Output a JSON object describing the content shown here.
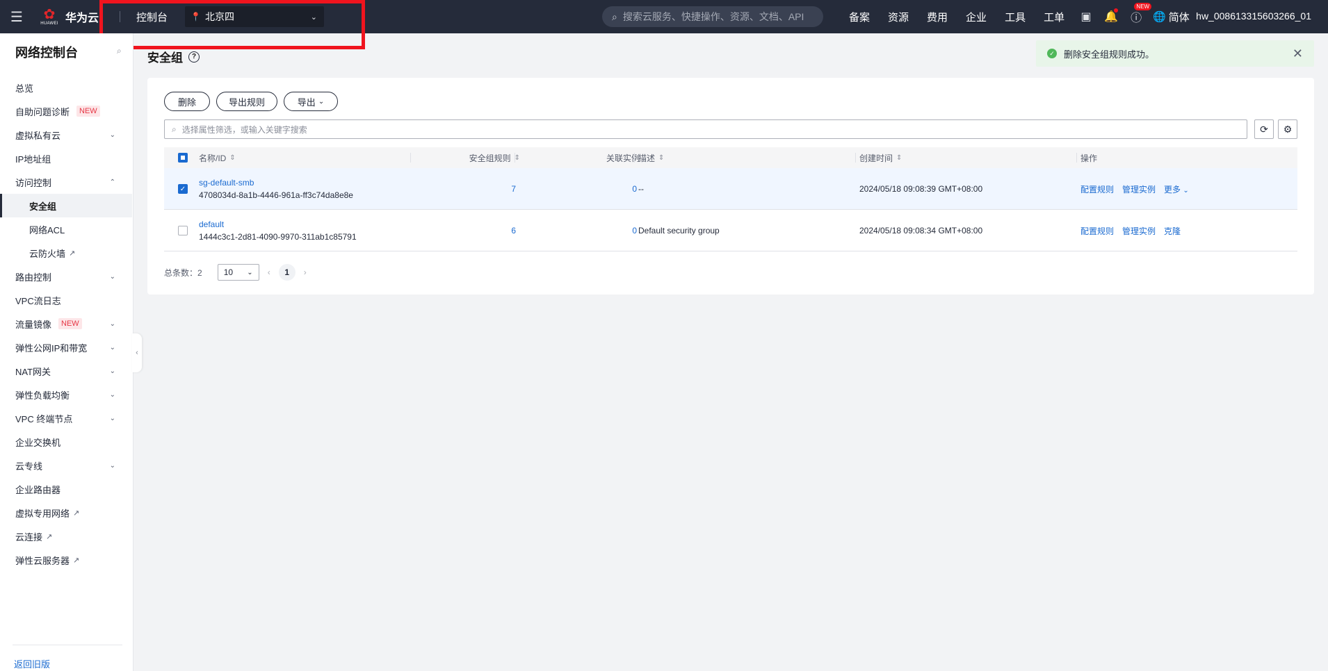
{
  "topbar": {
    "brand_sub": "HUAWEI",
    "brand": "华为云",
    "console": "控制台",
    "region": "北京四",
    "search_placeholder": "搜索云服务、快捷操作、资源、文档、API",
    "links": [
      "备案",
      "资源",
      "费用",
      "企业",
      "工具",
      "工单"
    ],
    "new_badge": "NEW",
    "lang": "简体",
    "user": "hw_008613315603266_01"
  },
  "sidebar": {
    "title": "网络控制台",
    "items": [
      {
        "label": "总览"
      },
      {
        "label": "自助问题诊断",
        "tag": "NEW"
      },
      {
        "label": "虚拟私有云"
      },
      {
        "label": "IP地址组"
      },
      {
        "label": "访问控制"
      },
      {
        "label": "安全组"
      },
      {
        "label": "网络ACL"
      },
      {
        "label": "云防火墙"
      },
      {
        "label": "路由控制"
      },
      {
        "label": "VPC流日志"
      },
      {
        "label": "流量镜像",
        "tag": "NEW"
      },
      {
        "label": "弹性公网IP和带宽"
      },
      {
        "label": "NAT网关"
      },
      {
        "label": "弹性负载均衡"
      },
      {
        "label": "VPC 终端节点"
      },
      {
        "label": "企业交换机"
      },
      {
        "label": "云专线"
      },
      {
        "label": "企业路由器"
      },
      {
        "label": "虚拟专用网络"
      },
      {
        "label": "云连接"
      },
      {
        "label": "弹性云服务器"
      }
    ],
    "back": "返回旧版"
  },
  "main": {
    "title": "安全组",
    "toast": "删除安全组规则成功。",
    "buttons": {
      "delete": "删除",
      "export_rules": "导出规则",
      "export": "导出"
    },
    "filter_placeholder": "选择属性筛选，或输入关键字搜索",
    "columns": {
      "name": "名称/ID",
      "rules": "安全组规则",
      "instances": "关联实例",
      "desc": "描述",
      "created": "创建时间",
      "ops": "操作"
    },
    "rows": [
      {
        "name": "sg-default-smb",
        "id": "4708034d-8a1b-4446-961a-ff3c74da8e8e",
        "rules": "7",
        "instances": "0",
        "desc": "--",
        "created": "2024/05/18 09:08:39 GMT+08:00",
        "op1": "配置规则",
        "op2": "管理实例",
        "op3": "更多"
      },
      {
        "name": "default",
        "id": "1444c3c1-2d81-4090-9970-311ab1c85791",
        "rules": "6",
        "instances": "0",
        "desc": "Default security group",
        "created": "2024/05/18 09:08:34 GMT+08:00",
        "op1": "配置规则",
        "op2": "管理实例",
        "op3": "克隆"
      }
    ],
    "pager": {
      "total_label": "总条数：2",
      "page_size": "10",
      "current": "1"
    }
  }
}
